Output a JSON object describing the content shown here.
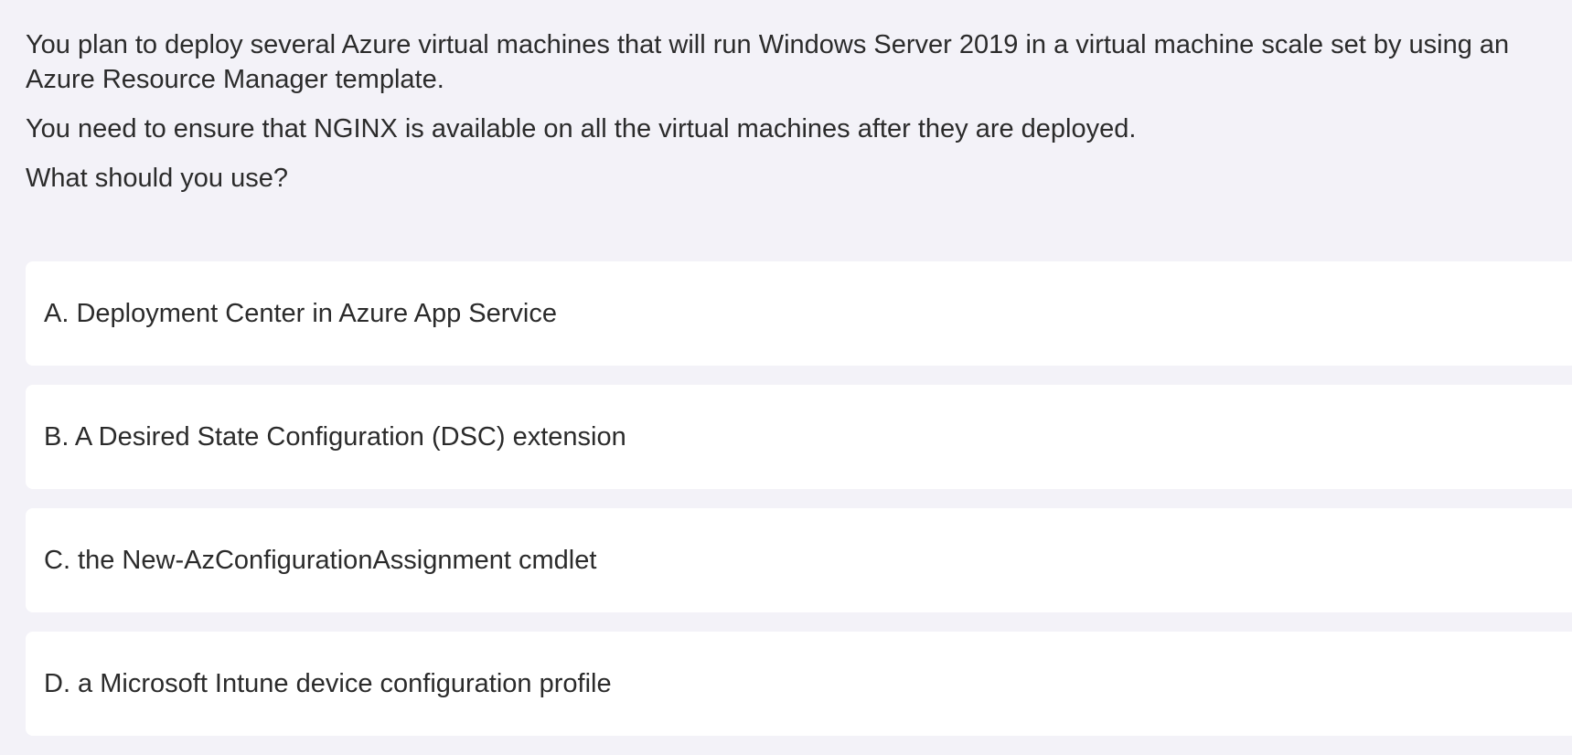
{
  "question": {
    "paragraphs": [
      "You plan to deploy several Azure virtual machines that will run Windows Server 2019 in a virtual machine scale set by using an Azure Resource Manager template.",
      "You need to ensure that NGINX is available on all the virtual machines after they are deployed.",
      "What should you use?"
    ]
  },
  "options": [
    {
      "label": "A. Deployment Center in Azure App Service"
    },
    {
      "label": "B. A Desired State Configuration (DSC) extension"
    },
    {
      "label": "C. the New-AzConfigurationAssignment cmdlet"
    },
    {
      "label": "D. a Microsoft Intune device configuration profile"
    }
  ],
  "colors": {
    "background": "#f3f2f8",
    "card": "#ffffff",
    "text": "#2b2b2b"
  }
}
